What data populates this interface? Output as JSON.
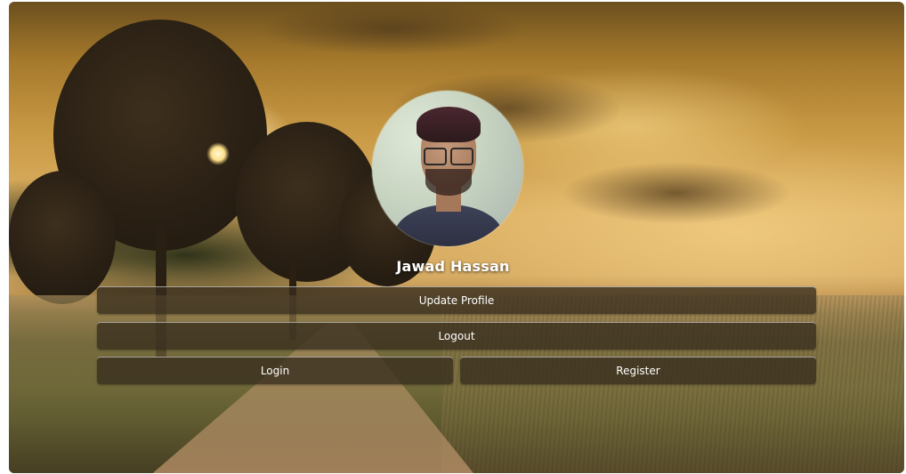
{
  "profile": {
    "name": "Jawad Hassan",
    "avatar_alt": "profile photo"
  },
  "actions": {
    "update_profile": "Update Profile",
    "logout": "Logout",
    "login": "Login",
    "register": "Register"
  },
  "colors": {
    "button_bg": "#372d1e",
    "text": "#ffffff"
  }
}
